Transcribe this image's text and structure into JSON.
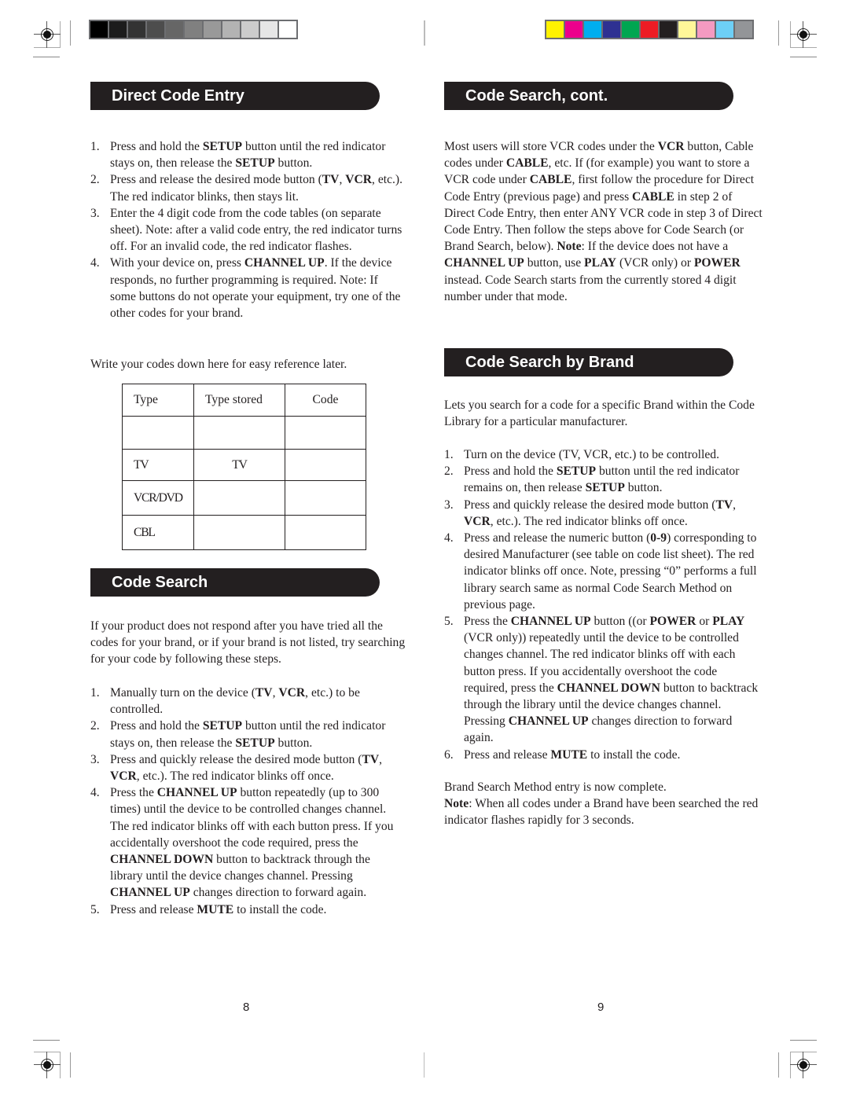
{
  "print_marks": {
    "grayscale_swatches": [
      "#000000",
      "#1c1c1c",
      "#333333",
      "#4d4d4d",
      "#666666",
      "#808080",
      "#999999",
      "#b3b3b3",
      "#cccccc",
      "#e6e6e6",
      "#ffffff"
    ],
    "color_swatches": [
      "#fff200",
      "#ec008c",
      "#00aeef",
      "#2e3192",
      "#00a651",
      "#ed1c24",
      "#231f20",
      "#fff799",
      "#f49ac1",
      "#6dcff6",
      "#939598"
    ],
    "registration_icon": "crosshair-target-icon"
  },
  "left_page": {
    "page_number": "8",
    "direct_code_entry": {
      "title": "Direct Code Entry",
      "steps": [
        {
          "num": "1.",
          "parts": [
            [
              "Press and hold the ",
              false
            ],
            [
              "SETUP",
              true
            ],
            [
              " button until the red indicator stays on, then release the ",
              false
            ],
            [
              "SETUP",
              true
            ],
            [
              " button.",
              false
            ]
          ]
        },
        {
          "num": "2.",
          "parts": [
            [
              "Press and release the desired mode button (",
              false
            ],
            [
              "TV",
              true
            ],
            [
              ", ",
              false
            ],
            [
              "VCR",
              true
            ],
            [
              ", etc.). The red indicator blinks, then stays lit.",
              false
            ]
          ]
        },
        {
          "num": "3.",
          "parts": [
            [
              "Enter the 4 digit code from the code tables (on separate sheet). Note: after a valid code entry, the red indicator turns off.  For an invalid code, the red indicator flashes.",
              false
            ]
          ]
        },
        {
          "num": "4.",
          "parts": [
            [
              "With your device on, press ",
              false
            ],
            [
              "CHANNEL UP",
              true
            ],
            [
              ". If the device responds, no further programming is required. Note: If some buttons do not operate your equipment, try one of the other codes for your brand.",
              false
            ]
          ]
        }
      ],
      "write_note": "Write your codes down here for easy reference later.",
      "table": {
        "headers": [
          "Type",
          "Type  stored",
          "Code"
        ],
        "rows": [
          [
            "",
            "",
            ""
          ],
          [
            "TV",
            "TV",
            ""
          ],
          [
            "VCR/DVD",
            "",
            ""
          ],
          [
            "CBL",
            "",
            ""
          ]
        ]
      }
    },
    "code_search": {
      "title": "Code Search",
      "intro": "If your product does not respond after you have tried all the codes for your brand, or if your brand is not listed, try searching for your code by following these steps.",
      "steps": [
        {
          "num": "1.",
          "parts": [
            [
              "Manually turn on the device (",
              false
            ],
            [
              "TV",
              true
            ],
            [
              ", ",
              false
            ],
            [
              "VCR",
              true
            ],
            [
              ", etc.) to be controlled.",
              false
            ]
          ]
        },
        {
          "num": "2.",
          "parts": [
            [
              "Press and hold the ",
              false
            ],
            [
              "SETUP",
              true
            ],
            [
              " button until the red indicator stays on, then release the ",
              false
            ],
            [
              "SETUP",
              true
            ],
            [
              " button.",
              false
            ]
          ]
        },
        {
          "num": "3.",
          "parts": [
            [
              "Press and quickly release the desired mode button (",
              false
            ],
            [
              "TV",
              true
            ],
            [
              ", ",
              false
            ],
            [
              "VCR",
              true
            ],
            [
              ", etc.). The red indicator blinks off once.",
              false
            ]
          ]
        },
        {
          "num": "4.",
          "parts": [
            [
              "Press the ",
              false
            ],
            [
              "CHANNEL UP",
              true
            ],
            [
              " button repeatedly (up to 300 times) until the device to be controlled changes channel. The red indicator blinks off with each button press.  If you accidentally overshoot the code required, press the ",
              false
            ],
            [
              "CHANNEL DOWN",
              true
            ],
            [
              " button to backtrack through the library until the device changes channel. Pressing ",
              false
            ],
            [
              "CHANNEL UP",
              true
            ],
            [
              " changes direction to forward again.",
              false
            ]
          ]
        },
        {
          "num": "5.",
          "parts": [
            [
              "Press and release ",
              false
            ],
            [
              "MUTE",
              true
            ],
            [
              " to install the code.",
              false
            ]
          ]
        }
      ]
    }
  },
  "right_page": {
    "page_number": "9",
    "code_search_cont": {
      "title": "Code Search, cont.",
      "body": [
        [
          "Most users will store VCR codes under the ",
          false
        ],
        [
          "VCR",
          true
        ],
        [
          " button, Cable codes under ",
          false
        ],
        [
          "CABLE",
          true
        ],
        [
          ", etc. If (for example) you want to store a VCR code under ",
          false
        ],
        [
          "CABLE",
          true
        ],
        [
          ", first follow the procedure for Direct Code Entry (previous page) and press ",
          false
        ],
        [
          "CABLE",
          true
        ],
        [
          " in step 2 of Direct Code Entry, then enter ANY VCR code in step 3 of Direct Code Entry. Then follow the steps above for Code Search (or Brand Search, below). ",
          false
        ],
        [
          "Note",
          true
        ],
        [
          ":  If the device does not have a ",
          false
        ],
        [
          "CHANNEL UP",
          true
        ],
        [
          " button, use ",
          false
        ],
        [
          "PLAY",
          true
        ],
        [
          " (VCR only) or ",
          false
        ],
        [
          "POWER",
          true
        ],
        [
          " instead. Code Search starts from the currently stored 4 digit number under that mode.",
          false
        ]
      ]
    },
    "code_search_by_brand": {
      "title": "Code Search by Brand",
      "intro": "Lets you search for a code for a specific Brand within the Code Library for a particular manufacturer.",
      "steps": [
        {
          "num": "1.",
          "parts": [
            [
              "Turn on the device (TV, VCR, etc.) to be controlled.",
              false
            ]
          ]
        },
        {
          "num": "2.",
          "parts": [
            [
              "Press and hold the ",
              false
            ],
            [
              "SETUP",
              true
            ],
            [
              " button until the red indicator remains on, then release ",
              false
            ],
            [
              "SETUP",
              true
            ],
            [
              " button.",
              false
            ]
          ]
        },
        {
          "num": "3.",
          "parts": [
            [
              "Press and quickly release the desired mode button (",
              false
            ],
            [
              "TV",
              true
            ],
            [
              ", ",
              false
            ],
            [
              "VCR",
              true
            ],
            [
              ", etc.). The red indicator blinks off once.",
              false
            ]
          ]
        },
        {
          "num": "4.",
          "parts": [
            [
              "Press and release the numeric button (",
              false
            ],
            [
              "0-9",
              true
            ],
            [
              ") corresponding to desired Manufacturer (see table on code list sheet).  The red indicator blinks off once. Note, pressing “0” performs a full library search same as normal Code Search Method on previous page.",
              false
            ]
          ]
        },
        {
          "num": "5.",
          "parts": [
            [
              "Press the ",
              false
            ],
            [
              "CHANNEL UP",
              true
            ],
            [
              " button ((or ",
              false
            ],
            [
              "POWER",
              true
            ],
            [
              " or ",
              false
            ],
            [
              "PLAY",
              true
            ],
            [
              " (VCR only)) repeatedly until the device to be controlled changes channel. The red indicator blinks off with each button press. If you accidentally overshoot the code required, press the ",
              false
            ],
            [
              "CHANNEL DOWN",
              true
            ],
            [
              " button to backtrack through the library until the device changes channel. Pressing ",
              false
            ],
            [
              "CHANNEL UP",
              true
            ],
            [
              " changes direction to forward again.",
              false
            ]
          ]
        },
        {
          "num": "6.",
          "parts": [
            [
              "Press and release ",
              false
            ],
            [
              "MUTE",
              true
            ],
            [
              " to install the code.",
              false
            ]
          ]
        }
      ],
      "complete_note": "Brand Search Method entry is now complete.",
      "final_note": [
        [
          "Note",
          true
        ],
        [
          ": When all codes under a Brand have been searched the red indicator flashes rapidly for 3 seconds.",
          false
        ]
      ]
    }
  }
}
